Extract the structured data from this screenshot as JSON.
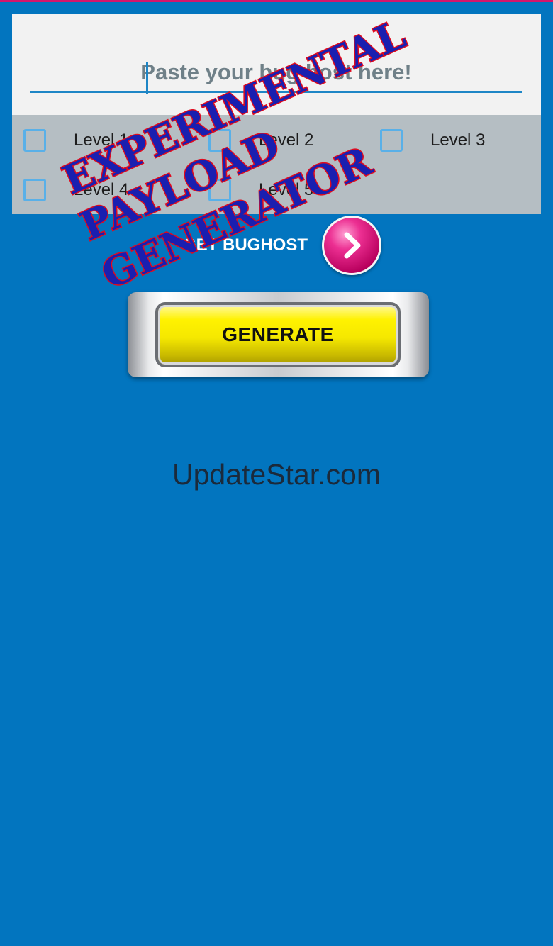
{
  "input": {
    "placeholder": "Paste your bug host here!"
  },
  "levels": [
    {
      "label": "Level 1",
      "checked": false
    },
    {
      "label": "Level 2",
      "checked": false
    },
    {
      "label": "Level 3",
      "checked": false
    },
    {
      "label": "Level 4",
      "checked": false
    },
    {
      "label": "Level 5",
      "checked": false
    }
  ],
  "bughost": {
    "label": "GET BUGHOST"
  },
  "generate": {
    "label": "GENERATE"
  },
  "watermark": {
    "text": "UpdateStar.com"
  },
  "stamp": {
    "lines": [
      "EXPERIMENTAL",
      "PAYLOAD",
      "GENERATOR"
    ]
  },
  "icons": {
    "arrow": "chevron-right-icon",
    "checkbox": "checkbox-icon"
  },
  "colors": {
    "background": "#0275bf",
    "accent": "#1e86c6",
    "checkbox_border": "#59b0e8",
    "stamp_fill": "#1a1fb0",
    "stamp_outline": "#e00b1e",
    "generate_yellow": "#fff200",
    "arrow_magenta": "#d4166b"
  }
}
